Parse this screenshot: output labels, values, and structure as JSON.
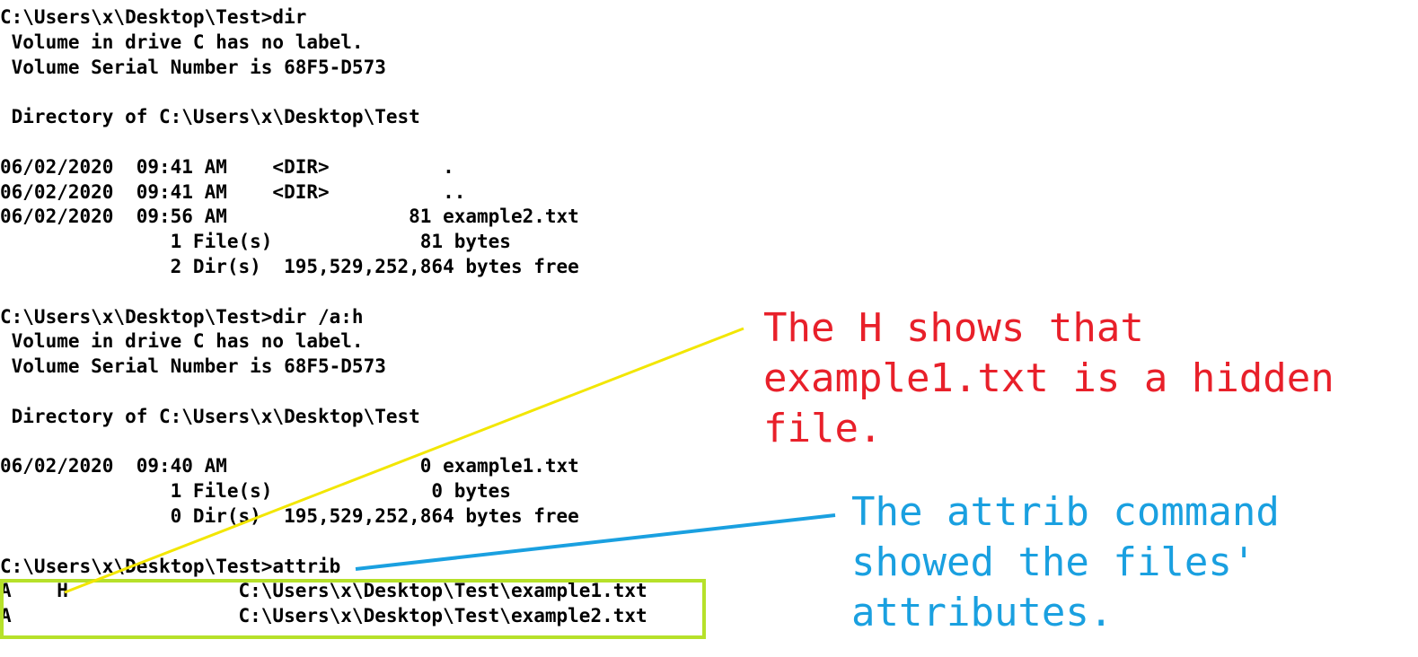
{
  "terminal": {
    "lines": [
      "C:\\Users\\x\\Desktop\\Test>dir",
      " Volume in drive C has no label.",
      " Volume Serial Number is 68F5-D573",
      "",
      " Directory of C:\\Users\\x\\Desktop\\Test",
      "",
      "06/02/2020  09:41 AM    <DIR>          .",
      "06/02/2020  09:41 AM    <DIR>          ..",
      "06/02/2020  09:56 AM                81 example2.txt",
      "               1 File(s)             81 bytes",
      "               2 Dir(s)  195,529,252,864 bytes free",
      "",
      "C:\\Users\\x\\Desktop\\Test>dir /a:h",
      " Volume in drive C has no label.",
      " Volume Serial Number is 68F5-D573",
      "",
      " Directory of C:\\Users\\x\\Desktop\\Test",
      "",
      "06/02/2020  09:40 AM                 0 example1.txt",
      "               1 File(s)              0 bytes",
      "               0 Dir(s)  195,529,252,864 bytes free",
      "",
      "C:\\Users\\x\\Desktop\\Test>attrib",
      "A    H               C:\\Users\\x\\Desktop\\Test\\example1.txt",
      "A                    C:\\Users\\x\\Desktop\\Test\\example2.txt"
    ]
  },
  "annotations": {
    "hidden_note": "The H shows that\nexample1.txt is a hidden\nfile.",
    "attrib_note": "The attrib command\nshowed the files'\nattributes."
  },
  "colors": {
    "hidden_note": "#e8202a",
    "attrib_note": "#1aa0e0",
    "hidden_pointer": "#f2e600",
    "attrib_pointer": "#1aa0e0",
    "result_box": "#b6e12a",
    "attrib_underline": "#e02020"
  }
}
